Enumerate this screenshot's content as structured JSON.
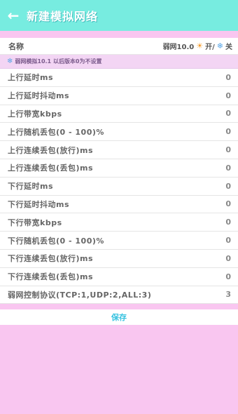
{
  "colors": {
    "header_bg": "#77ece0",
    "page_bg": "#f9c6f0",
    "panel_bg": "#ffffff",
    "save_text": "#39c3e0"
  },
  "header": {
    "back_icon": "←",
    "title": "新建模拟网络"
  },
  "name_row": {
    "label": "名称",
    "right_text": "弱网10.0",
    "sun_icon": "☀",
    "toggle_text": "开/",
    "snow_icon": "❄",
    "off_text": "关"
  },
  "notice": {
    "icon": "❄",
    "text": "弱网模拟10.1 以后版本0为不设置"
  },
  "rows": [
    {
      "label": "上行延时ms",
      "value": "0"
    },
    {
      "label": "上行延时抖动ms",
      "value": "0"
    },
    {
      "label": "上行带宽kbps",
      "value": "0"
    },
    {
      "label": "上行随机丢包(0 - 100)%",
      "value": "0"
    },
    {
      "label": "上行连续丢包(放行)ms",
      "value": "0"
    },
    {
      "label": "上行连续丢包(丢包)ms",
      "value": "0"
    },
    {
      "label": "下行延时ms",
      "value": "0"
    },
    {
      "label": "下行延时抖动ms",
      "value": "0"
    },
    {
      "label": "下行带宽kbps",
      "value": "0"
    },
    {
      "label": "下行随机丢包(0 - 100)%",
      "value": "0"
    },
    {
      "label": "下行连续丢包(放行)ms",
      "value": "0"
    },
    {
      "label": "下行连续丢包(丢包)ms",
      "value": "0"
    },
    {
      "label": "弱网控制协议(TCP:1,UDP:2,ALL:3)",
      "value": "3"
    }
  ],
  "save": {
    "label": "保存"
  }
}
